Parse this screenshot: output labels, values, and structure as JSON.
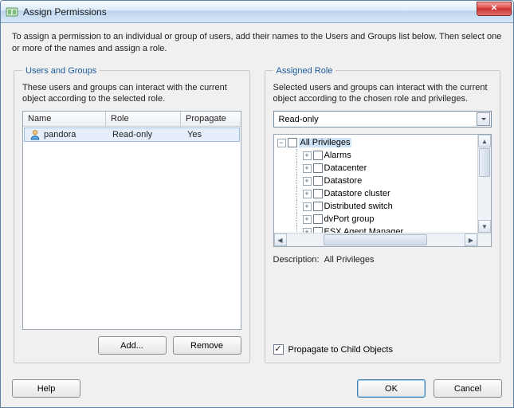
{
  "window": {
    "title": "Assign Permissions"
  },
  "intro": "To assign a permission to an individual or group of users, add their names to the Users and Groups list below. Then select one or more of the names and assign a role.",
  "left": {
    "legend": "Users and Groups",
    "desc": "These users and groups can interact with the current object according to the selected role.",
    "columns": {
      "name": "Name",
      "role": "Role",
      "propagate": "Propagate"
    },
    "rows": [
      {
        "name": "pandora",
        "role": "Read-only",
        "propagate": "Yes"
      }
    ],
    "add": "Add...",
    "remove": "Remove"
  },
  "right": {
    "legend": "Assigned Role",
    "desc": "Selected users and groups can interact with the current object according to the chosen role and privileges.",
    "selected_role": "Read-only",
    "tree": {
      "root": "All Privileges",
      "children": [
        "Alarms",
        "Datacenter",
        "Datastore",
        "Datastore cluster",
        "Distributed switch",
        "dvPort group",
        "ESX Agent Manager"
      ]
    },
    "description_label": "Description:",
    "description_value": "All Privileges",
    "propagate_label": "Propagate to Child Objects",
    "propagate_checked": true
  },
  "footer": {
    "help": "Help",
    "ok": "OK",
    "cancel": "Cancel"
  }
}
